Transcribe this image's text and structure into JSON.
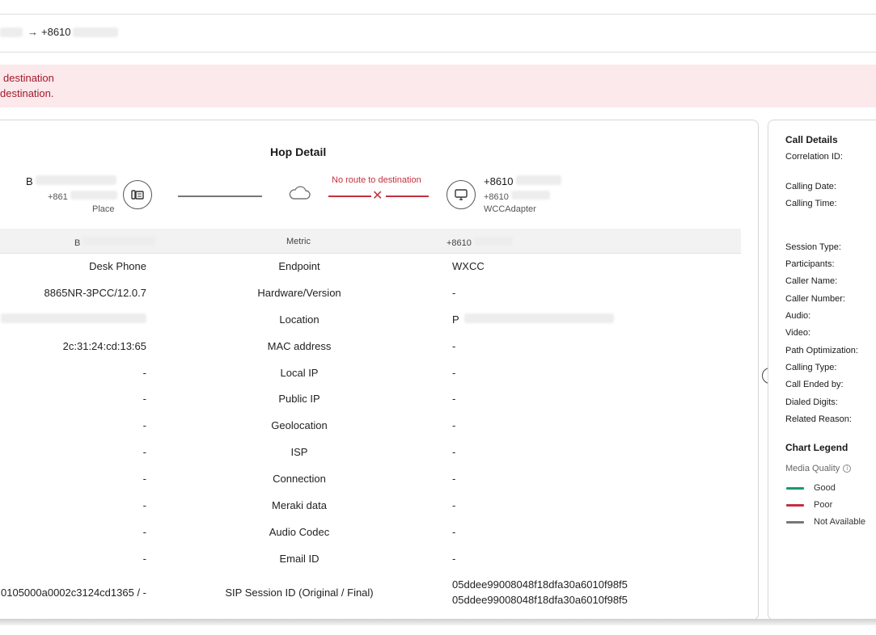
{
  "route": {
    "source_partial": "",
    "arrow": "→",
    "destination": "+8610"
  },
  "alert": {
    "line1": "destination",
    "line2": "destination."
  },
  "hop": {
    "title": "Hop Detail",
    "source": {
      "name": "B",
      "number": "+861",
      "type": "Place"
    },
    "error_text": "No route to destination",
    "dest": {
      "name": "+8610",
      "number": "+8610",
      "type": "WCCAdapter"
    }
  },
  "table": {
    "headers": {
      "left": "B",
      "mid": "Metric",
      "right": "+8610"
    },
    "rows": [
      {
        "left": "Desk Phone",
        "metric": "Endpoint",
        "right": "WXCC"
      },
      {
        "left": "8865NR-3PCC/12.0.7",
        "metric": "Hardware/Version",
        "right": "-"
      },
      {
        "left": "",
        "metric": "Location",
        "right": "P"
      },
      {
        "left": "2c:31:24:cd:13:65",
        "metric": "MAC address",
        "right": "-"
      },
      {
        "left": "-",
        "metric": "Local IP",
        "right": "-"
      },
      {
        "left": "-",
        "metric": "Public IP",
        "right": "-"
      },
      {
        "left": "-",
        "metric": "Geolocation",
        "right": "-"
      },
      {
        "left": "-",
        "metric": "ISP",
        "right": "-"
      },
      {
        "left": "-",
        "metric": "Connection",
        "right": "-"
      },
      {
        "left": "-",
        "metric": "Meraki data",
        "right": "-"
      },
      {
        "left": "-",
        "metric": "Audio Codec",
        "right": "-"
      },
      {
        "left": "-",
        "metric": "Email ID",
        "right": "-"
      },
      {
        "left": "0105000a0002c3124cd1365 / -",
        "metric": "SIP Session ID (Original / Final)",
        "right": "05ddee99008048f18dfa30a6010f98f5",
        "right2": "05ddee99008048f18dfa30a6010f98f5"
      }
    ]
  },
  "call_details": {
    "title": "Call Details",
    "labels": [
      "Correlation ID:",
      "Calling Date:",
      "Calling Time:",
      "Session Type:",
      "Participants:",
      "Caller Name:",
      "Caller Number:",
      "Audio:",
      "Video:",
      "Path Optimization:",
      "Calling Type:",
      "Call Ended by:",
      "Dialed Digits:",
      "Related Reason:"
    ]
  },
  "legend": {
    "title": "Chart Legend",
    "subtitle": "Media Quality",
    "items": [
      {
        "label": "Good",
        "color": "#1a9a6c"
      },
      {
        "label": "Poor",
        "color": "#c4303f"
      },
      {
        "label": "Not Available",
        "color": "#777777"
      }
    ]
  }
}
